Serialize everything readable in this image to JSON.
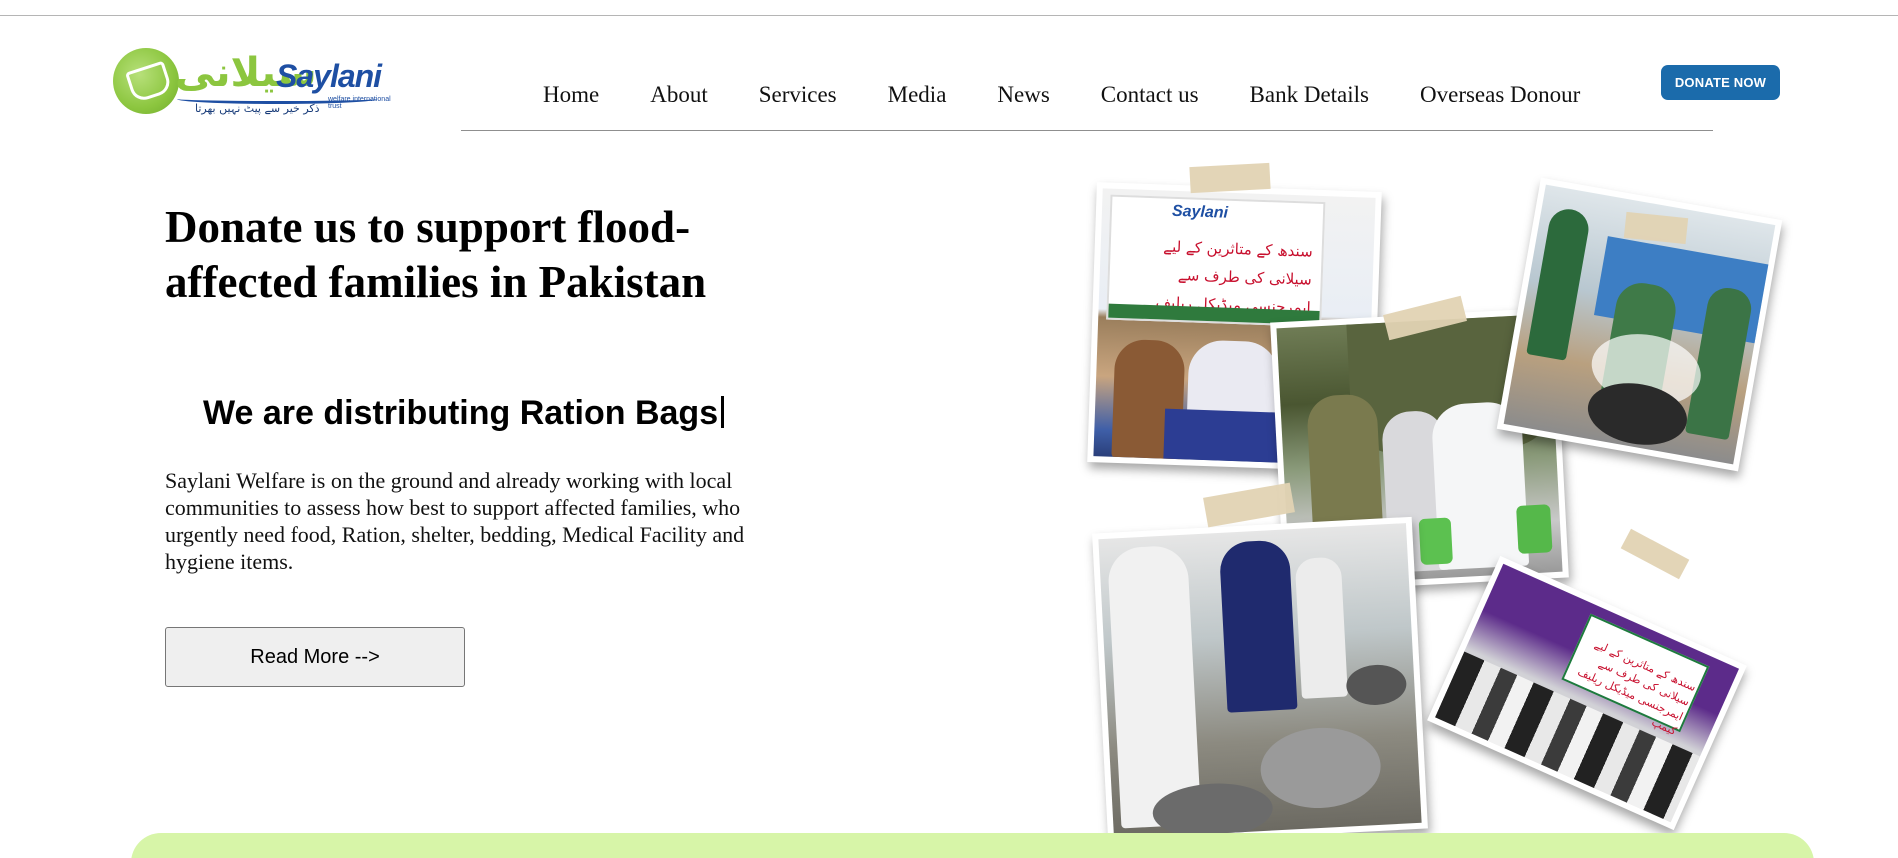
{
  "logo": {
    "urdu": "سیلانی",
    "word": "Saylani",
    "tagline": "welfare international trust",
    "subtagline": "ذکر خیر سے پیٹ نہیں بھرتا"
  },
  "nav": {
    "items": [
      {
        "label": "Home"
      },
      {
        "label": "About"
      },
      {
        "label": "Services"
      },
      {
        "label": "Media"
      },
      {
        "label": "News"
      },
      {
        "label": "Contact us"
      },
      {
        "label": "Bank Details"
      },
      {
        "label": "Overseas Donour"
      }
    ],
    "donate_label": "DONATE NOW"
  },
  "hero": {
    "title": "Donate us to support flood-affected families in Pakistan",
    "typing_text": "We are distributing Ration Bags",
    "body": "Saylani Welfare is on the ground and already working with local communities to assess how best to support affected families, who urgently need food, Ration, shelter, bedding, Medical Facility and hygiene items.",
    "button_label": "Read More -->"
  },
  "collage": {
    "banner_brand": "Saylani",
    "banner_urdu": "سندھ کے متاثرین کے لیے سیلانی کی طرف سے ایمرجنسی میڈیکل ریلیف کیمپ",
    "banner_urdu_short": "سندھ کے متاثرین کے لیے سیلانی کی طرف سے ایمرجنسی میڈیکل ریلیف کیمپ"
  },
  "colors": {
    "brand_blue": "#1b6bab",
    "brand_green": "#8cc63f",
    "footer_band": "#d7f5a8"
  }
}
